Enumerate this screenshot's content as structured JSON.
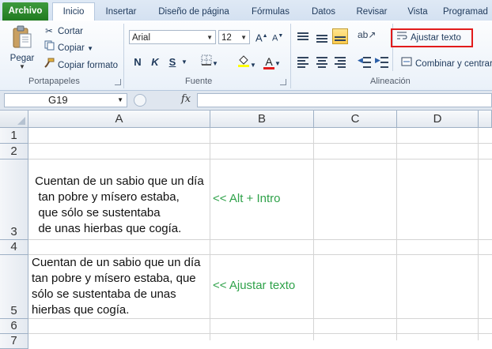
{
  "ribbon_tabs": [
    "Archivo",
    "Inicio",
    "Insertar",
    "Diseño de página",
    "Fórmulas",
    "Datos",
    "Revisar",
    "Vista",
    "Programad"
  ],
  "clipboard": {
    "paste_label": "Pegar",
    "cut_label": "Cortar",
    "copy_label": "Copiar",
    "format_painter_label": "Copiar formato",
    "group_label": "Portapapeles"
  },
  "font": {
    "font_name": "Arial",
    "font_size": "12",
    "bold": "N",
    "italic": "K",
    "underline": "S",
    "group_label": "Fuente"
  },
  "alignment": {
    "wrap_text_label": "Ajustar texto",
    "merge_center_label": "Combinar y centrar",
    "group_label": "Alineación"
  },
  "formula_bar": {
    "name_box": "G19",
    "fx_label": "fx",
    "formula": ""
  },
  "columns": [
    "A",
    "B",
    "C",
    "D"
  ],
  "rows": [
    "1",
    "2",
    "3",
    "4",
    "5",
    "6",
    "7"
  ],
  "cells": {
    "A3": " Cuentan de un sabio que un día\n  tan pobre y mísero estaba,\n  que sólo se sustentaba\n  de unas hierbas que cogía.",
    "B3": "<< Alt + Intro",
    "A5": "Cuentan de un sabio que un día\ntan pobre y mísero estaba, que\nsólo se sustentaba de unas\nhierbas que cogía.",
    "B5": "<< Ajustar texto"
  },
  "colors": {
    "file_tab": "#2a8a2a",
    "highlight_box": "#e21b1b",
    "note_text": "#2fa24a"
  }
}
